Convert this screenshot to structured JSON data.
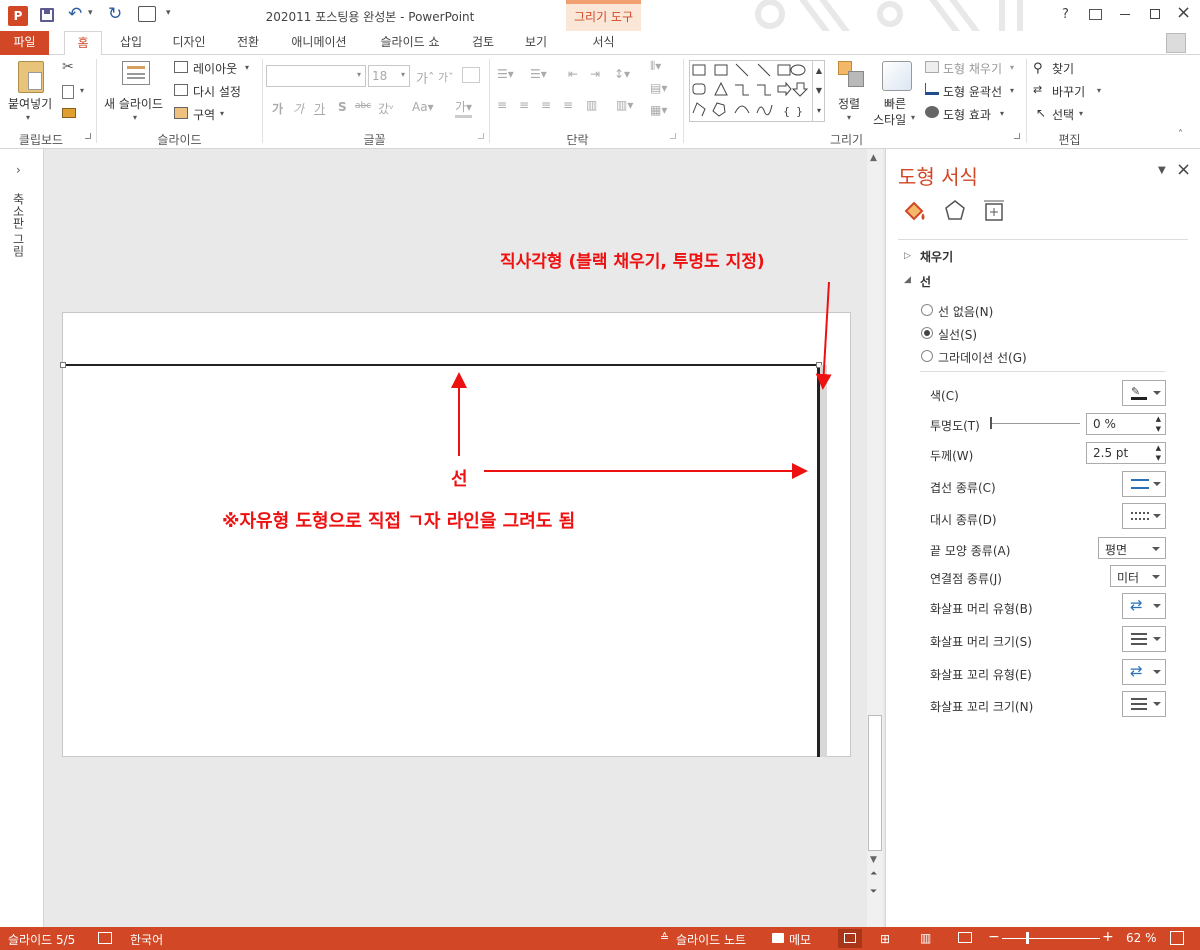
{
  "window": {
    "title": "202011 포스팅용 완성본 - PowerPoint",
    "context_tab_group": "그리기 도구"
  },
  "quick_access": {
    "app_icon": "powerpoint-icon",
    "save": "save-icon",
    "undo": "undo-icon",
    "redo": "redo-icon",
    "present": "present-from-start-icon"
  },
  "window_controls": {
    "help": "?",
    "ribbon_display": "ribbon-display-icon",
    "minimize": "minimize-icon",
    "restore": "restore-icon",
    "close": "close-icon"
  },
  "tabs": [
    {
      "label": "파일"
    },
    {
      "label": "홈"
    },
    {
      "label": "삽입"
    },
    {
      "label": "디자인"
    },
    {
      "label": "전환"
    },
    {
      "label": "애니메이션"
    },
    {
      "label": "슬라이드 쇼"
    },
    {
      "label": "검토"
    },
    {
      "label": "보기"
    },
    {
      "label": "서식"
    }
  ],
  "ribbon": {
    "clipboard": {
      "paste": "붙여넣기",
      "group": "클립보드"
    },
    "slides": {
      "new_slide": "새 슬라이드",
      "layout": "레이아웃",
      "reset": "다시 설정",
      "section": "구역",
      "group": "슬라이드"
    },
    "font": {
      "font_name": "",
      "font_size": "18",
      "group": "글꼴"
    },
    "paragraph": {
      "group": "단락"
    },
    "drawing": {
      "arrange": "정렬",
      "quick_styles": "빠른\n스타일",
      "quick_1": "빠른",
      "quick_2": "스타일",
      "shape_fill": "도형 채우기",
      "shape_outline": "도형 윤곽선",
      "shape_effects": "도형 효과",
      "group": "그리기"
    },
    "editing": {
      "find": "찾기",
      "replace": "바꾸기",
      "select": "선택",
      "group": "편집"
    }
  },
  "thumbnail_pane": {
    "label": "축소판 그림"
  },
  "slide": {
    "annotation_rect": "직사각형 (블랙 채우기, 투명도 지정)",
    "annotation_line": "선",
    "annotation_note": "※자유형 도형으로 직접 ㄱ자 라인을 그려도 됨"
  },
  "format_pane": {
    "title": "도형 서식",
    "fill_section": "채우기",
    "line_section": "선",
    "radio_none": "선 없음(N)",
    "radio_solid": "실선(S)",
    "radio_gradient": "그라데이션 선(G)",
    "color_label": "색(C)",
    "transparency_label": "투명도(T)",
    "transparency_value": "0 %",
    "width_label": "두께(W)",
    "width_value": "2.5 pt",
    "compound_label": "겹선 종류(C)",
    "dash_label": "대시 종류(D)",
    "cap_label": "끝 모양 종류(A)",
    "cap_value": "평면",
    "join_label": "연결점 종류(J)",
    "join_value": "미터",
    "begin_type_label": "화살표 머리 유형(B)",
    "begin_size_label": "화살표 머리 크기(S)",
    "end_type_label": "화살표 꼬리 유형(E)",
    "end_size_label": "화살표 꼬리 크기(N)"
  },
  "status": {
    "slide_info": "슬라이드 5/5",
    "language": "한국어",
    "notes": "슬라이드 노트",
    "comments": "메모",
    "zoom": "62 %"
  },
  "colors": {
    "accent": "#d24726",
    "annotation": "#e11111"
  }
}
